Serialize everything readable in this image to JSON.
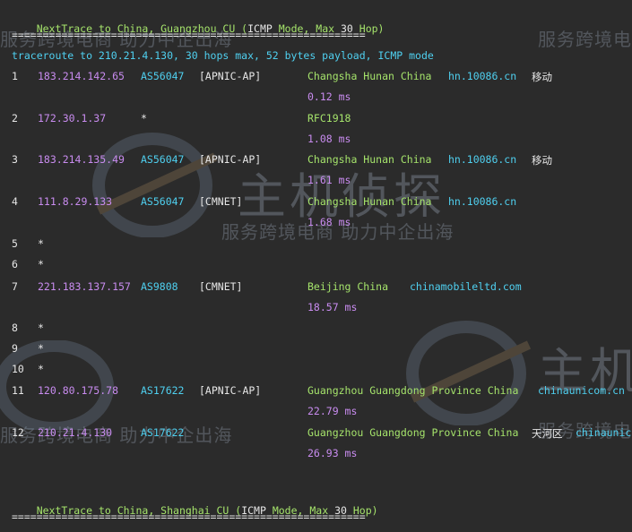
{
  "header1": {
    "prefix": "NextTrace to China, Guangzhou CU (",
    "mode": "ICMP",
    "middle": " Mode, Max ",
    "max": "30",
    "suffix": " Hop)",
    "rule": "========================================================="
  },
  "traceroute_line": "traceroute to 210.21.4.130, 30 hops max, 52 bytes payload, ICMP mode",
  "hops": [
    {
      "n": "1",
      "ip": "183.214.142.65",
      "asn": "AS56047",
      "tag": "[APNIC-AP]",
      "geo": "Changsha Hunan China",
      "host": "hn.10086.cn",
      "isp": "移动",
      "ms": "0.12 ms"
    },
    {
      "n": "2",
      "ip": "172.30.1.37",
      "asn": "*",
      "tag": "",
      "geo": "RFC1918",
      "host": "",
      "isp": "",
      "ms": "1.08 ms"
    },
    {
      "n": "3",
      "ip": "183.214.135.49",
      "asn": "AS56047",
      "tag": "[APNIC-AP]",
      "geo": "Changsha Hunan China",
      "host": "hn.10086.cn",
      "isp": "移动",
      "ms": "1.61 ms"
    },
    {
      "n": "4",
      "ip": "111.8.29.133",
      "asn": "AS56047",
      "tag": "[CMNET]",
      "geo": "Changsha Hunan China",
      "host": "hn.10086.cn",
      "isp": "",
      "ms": "1.68 ms"
    },
    {
      "n": "5",
      "star": "*"
    },
    {
      "n": "6",
      "star": "*"
    },
    {
      "n": "7",
      "ip": "221.183.137.157",
      "asn": "AS9808",
      "tag": "[CMNET]",
      "geo": "Beijing China",
      "host": "chinamobileltd.com",
      "isp": "",
      "ms": "18.57 ms"
    },
    {
      "n": "8",
      "star": "*"
    },
    {
      "n": "9",
      "star": "*"
    },
    {
      "n": "10",
      "star": "*"
    },
    {
      "n": "11",
      "ip": "120.80.175.78",
      "asn": "AS17622",
      "tag": "[APNIC-AP]",
      "geo": "Guangzhou Guangdong Province China",
      "host": "chinaunicom.cn",
      "isp": "",
      "ms": "22.79 ms"
    },
    {
      "n": "12",
      "ip": "210.21.4.130",
      "asn": "AS17622",
      "tag": "",
      "geo": "Guangzhou Guangdong Province China",
      "host": "chinaunicom.cn",
      "isp": "天河区",
      "ms": "26.93 ms"
    }
  ],
  "header2": {
    "prefix": "NextTrace to China, Shanghai CU (",
    "mode": "ICMP",
    "middle": " Mode, Max ",
    "max": "30",
    "suffix": " Hop)",
    "rule": "========================================================="
  },
  "watermark": {
    "brand": "主机侦探",
    "slogan": "服务跨境电商 助力中企出海"
  },
  "colors": {
    "background": "#2b2b2b",
    "green": "#a5e36b",
    "purple": "#c98cf0",
    "cyan": "#4fd0f0"
  }
}
